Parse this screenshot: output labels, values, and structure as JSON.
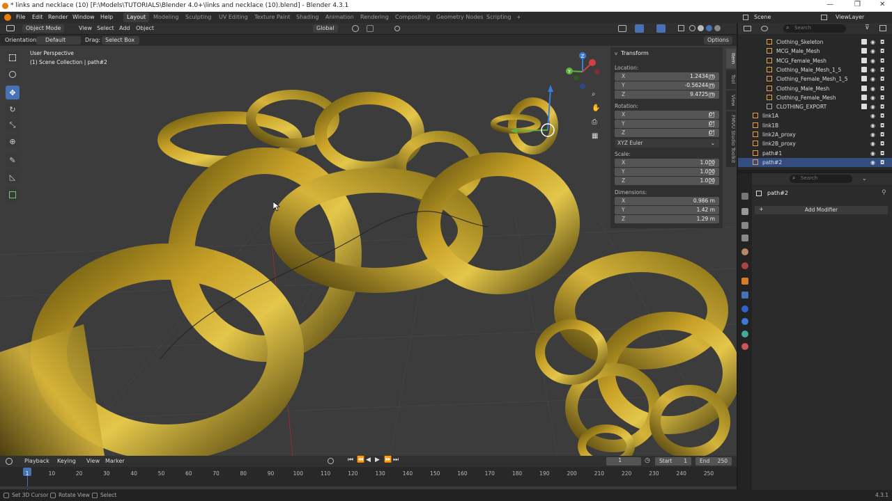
{
  "window": {
    "title": "* links and necklace (10) [F:\\Models\\TUTORIALS\\Blender 4.0+\\links and necklace (10).blend] - Blender 4.3.1",
    "controls": [
      "—",
      "❐",
      "✕"
    ]
  },
  "menu": [
    "File",
    "Edit",
    "Render",
    "Window",
    "Help"
  ],
  "workspaces": [
    "Layout",
    "Modeling",
    "Sculpting",
    "UV Editing",
    "Texture Paint",
    "Shading",
    "Animation",
    "Rendering",
    "Compositing",
    "Geometry Nodes",
    "Scripting",
    "+"
  ],
  "active_workspace": "Layout",
  "scene": {
    "label": "Scene",
    "view_layer": "ViewLayer"
  },
  "viewport_header": {
    "mode": "Object Mode",
    "menus": [
      "View",
      "Select",
      "Add",
      "Object"
    ],
    "transform_orientation": "Global",
    "orientation_label": "Orientation:",
    "orientation_value": "Default",
    "drag_label": "Drag:",
    "drag_value": "Select Box",
    "options": "Options"
  },
  "viewport": {
    "perspective": "User Perspective",
    "collection": "(1) Scene Collection | path#2"
  },
  "gizmo": {
    "x": "X",
    "y": "Y",
    "z": "Z"
  },
  "npanel": {
    "section": "Transform",
    "location_label": "Location:",
    "location": [
      {
        "axis": "X",
        "value": "1.2434 m"
      },
      {
        "axis": "Y",
        "value": "-0.56244 m"
      },
      {
        "axis": "Z",
        "value": "9.4725 m"
      }
    ],
    "rotation_label": "Rotation:",
    "rotation": [
      {
        "axis": "X",
        "value": "0°"
      },
      {
        "axis": "Y",
        "value": "0°"
      },
      {
        "axis": "Z",
        "value": "0°"
      }
    ],
    "rotation_mode": "XYZ Euler",
    "scale_label": "Scale:",
    "scale": [
      {
        "axis": "X",
        "value": "1.000"
      },
      {
        "axis": "Y",
        "value": "1.000"
      },
      {
        "axis": "Z",
        "value": "1.000"
      }
    ],
    "dimensions_label": "Dimensions:",
    "dimensions": [
      {
        "axis": "X",
        "value": "0.986 m"
      },
      {
        "axis": "Y",
        "value": "1.42 m"
      },
      {
        "axis": "Z",
        "value": "1.29 m"
      }
    ],
    "tabs": [
      "Item",
      "Tool",
      "View",
      "FMVU Studio Toolkit"
    ]
  },
  "outliner": {
    "search_placeholder": "Search",
    "items": [
      {
        "name": "Clothing_Skeleton",
        "selected": false
      },
      {
        "name": "MCG_Male_Mesh",
        "selected": false
      },
      {
        "name": "MCG_Female_Mesh",
        "selected": false
      },
      {
        "name": "Clothing_Male_Mesh_1_5",
        "selected": false
      },
      {
        "name": "Clothing_Female_Mesh_1_5",
        "selected": false
      },
      {
        "name": "Clothing_Male_Mesh",
        "selected": false
      },
      {
        "name": "Clothing_Female_Mesh",
        "selected": false
      },
      {
        "name": "CLOTHING_EXPORT",
        "selected": false
      },
      {
        "name": "link1A",
        "selected": false
      },
      {
        "name": "link1B",
        "selected": false
      },
      {
        "name": "link2A_proxy",
        "selected": false
      },
      {
        "name": "link2B_proxy",
        "selected": false
      },
      {
        "name": "path#1",
        "selected": false
      },
      {
        "name": "path#2",
        "selected": true
      }
    ]
  },
  "properties": {
    "search_placeholder": "Search",
    "object_name": "path#2",
    "add_modifier": "Add Modifier"
  },
  "timeline": {
    "menus": [
      "Playback",
      "Keying",
      "View",
      "Marker"
    ],
    "current_frame": "1",
    "start_label": "Start",
    "start": "1",
    "end_label": "End",
    "end": "250",
    "ticks": [
      "1",
      "10",
      "20",
      "30",
      "40",
      "50",
      "60",
      "70",
      "80",
      "90",
      "100",
      "110",
      "120",
      "130",
      "140",
      "150",
      "160",
      "170",
      "180",
      "190",
      "200",
      "210",
      "220",
      "230",
      "240",
      "250"
    ]
  },
  "status": {
    "items": [
      "Set 3D Cursor",
      "Rotate View",
      "Select"
    ],
    "version": "4.3.1"
  },
  "colors": {
    "accent": "#4772b3",
    "gold": "#c9a227",
    "selection": "#334d80"
  }
}
